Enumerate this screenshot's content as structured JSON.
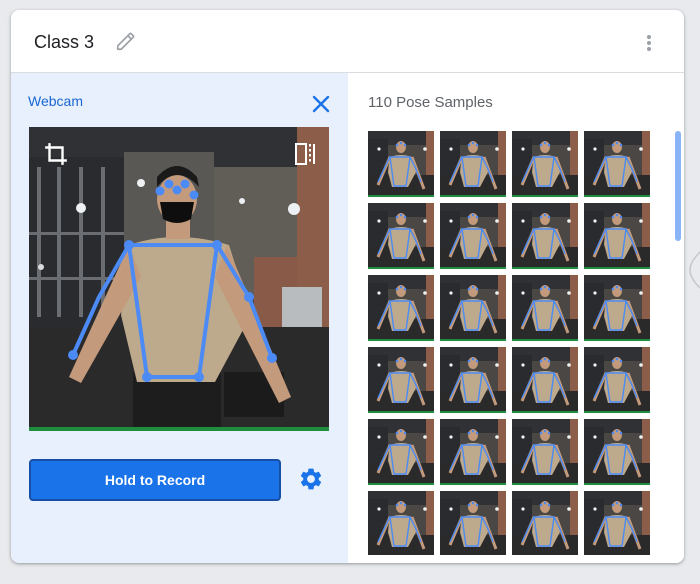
{
  "card": {
    "title": "Class 3",
    "icons": {
      "edit": "pencil-icon",
      "menu": "more-vert-icon"
    }
  },
  "webcam": {
    "label": "Webcam",
    "close_icon": "close-icon",
    "crop_icon": "crop-icon",
    "flip_icon": "flip-horizontal-icon"
  },
  "record": {
    "label": "Hold to Record",
    "settings_icon": "gear-icon"
  },
  "samples": {
    "label": "110 Pose Samples",
    "visible_thumbnails": 24
  },
  "colors": {
    "accent": "#1a73e8",
    "accent_text": "#1967d2",
    "pose_overlay": "#4c8bf5",
    "left_pane_bg": "#e8f0fe",
    "record_bar": "#1e8e3e"
  }
}
